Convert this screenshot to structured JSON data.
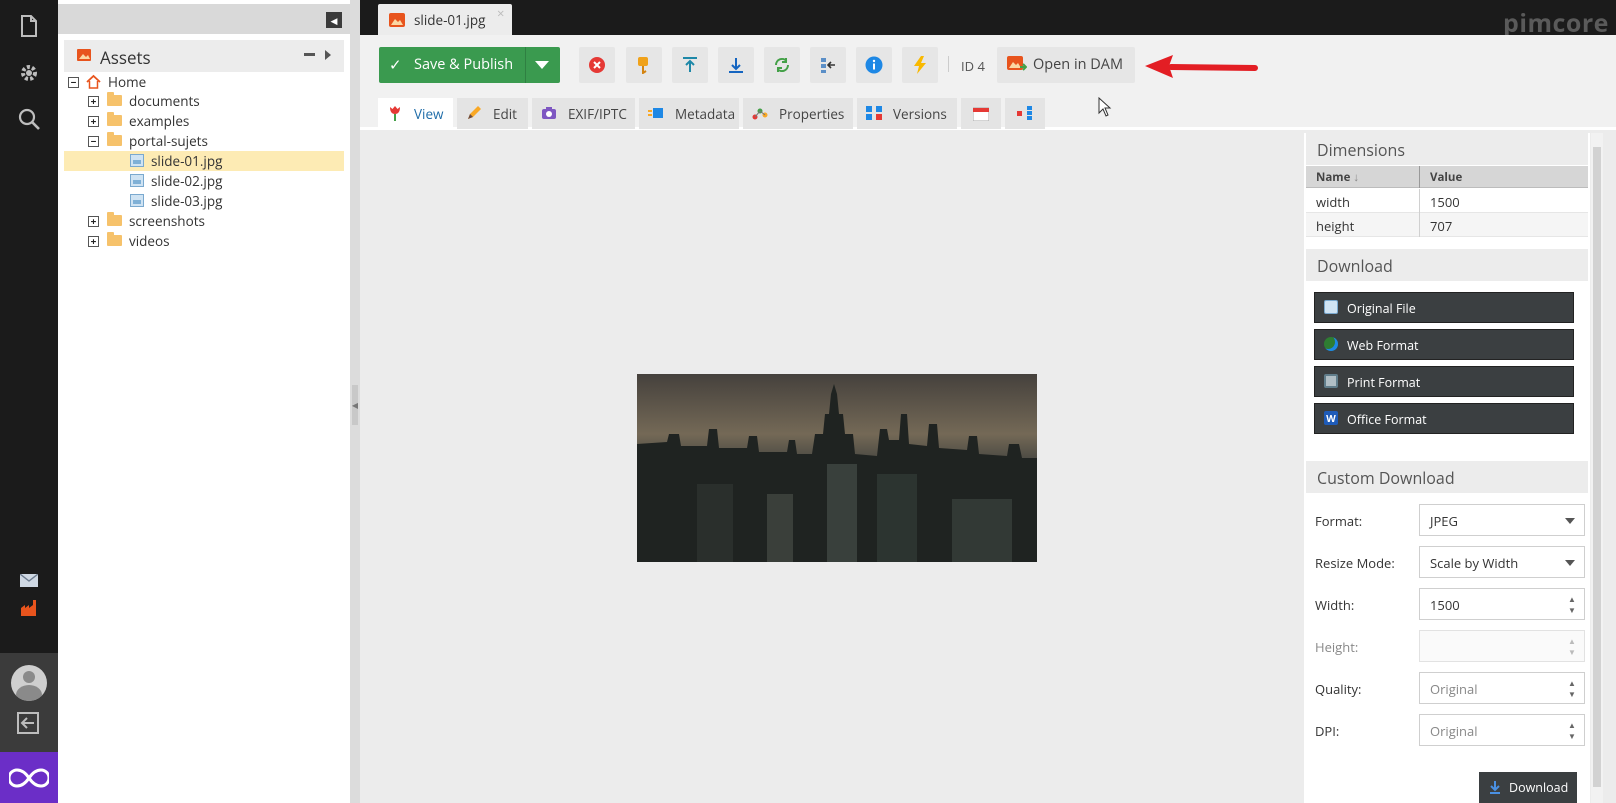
{
  "app": {
    "brand": "pimcore"
  },
  "rail": {
    "icons": [
      "documents-icon",
      "settings-icon",
      "search-icon",
      "mail-icon",
      "factory-icon",
      "avatar",
      "logout-icon",
      "pimcore-logo"
    ]
  },
  "tree": {
    "title": "Assets",
    "items": [
      {
        "label": "Home",
        "level": 0,
        "expanded": true
      },
      {
        "label": "documents",
        "level": 1,
        "expanded": false
      },
      {
        "label": "examples",
        "level": 1,
        "expanded": false
      },
      {
        "label": "portal-sujets",
        "level": 1,
        "expanded": true
      },
      {
        "label": "slide-01.jpg",
        "level": 2,
        "selected": true
      },
      {
        "label": "slide-02.jpg",
        "level": 2
      },
      {
        "label": "slide-03.jpg",
        "level": 2
      },
      {
        "label": "screenshots",
        "level": 1,
        "expanded": false
      },
      {
        "label": "videos",
        "level": 1,
        "expanded": false
      }
    ]
  },
  "doc_tab": {
    "label": "slide-01.jpg",
    "close": "×"
  },
  "toolbar": {
    "save_label": "Save & Publish",
    "id_label": "ID 4",
    "dam_label": "Open in DAM"
  },
  "subtabs": [
    "View",
    "Edit",
    "EXIF/IPTC",
    "Metadata",
    "Properties",
    "Versions"
  ],
  "dimensions": {
    "title": "Dimensions",
    "col_name": "Name",
    "col_value": "Value",
    "rows": [
      {
        "name": "width",
        "value": "1500"
      },
      {
        "name": "height",
        "value": "707"
      }
    ]
  },
  "download": {
    "title": "Download",
    "buttons": [
      "Original File",
      "Web Format",
      "Print Format",
      "Office Format"
    ]
  },
  "custom_download": {
    "title": "Custom Download",
    "format_label": "Format:",
    "format_value": "JPEG",
    "resize_label": "Resize Mode:",
    "resize_value": "Scale by Width",
    "width_label": "Width:",
    "width_value": "1500",
    "height_label": "Height:",
    "quality_label": "Quality:",
    "quality_placeholder": "Original",
    "dpi_label": "DPI:",
    "dpi_placeholder": "Original",
    "download_label": "Download"
  },
  "colors": {
    "accent_green": "#3a9a4f",
    "selection": "#fdebb4",
    "logo_purple": "#6b2ec7",
    "annotation_red": "#e31e24"
  }
}
